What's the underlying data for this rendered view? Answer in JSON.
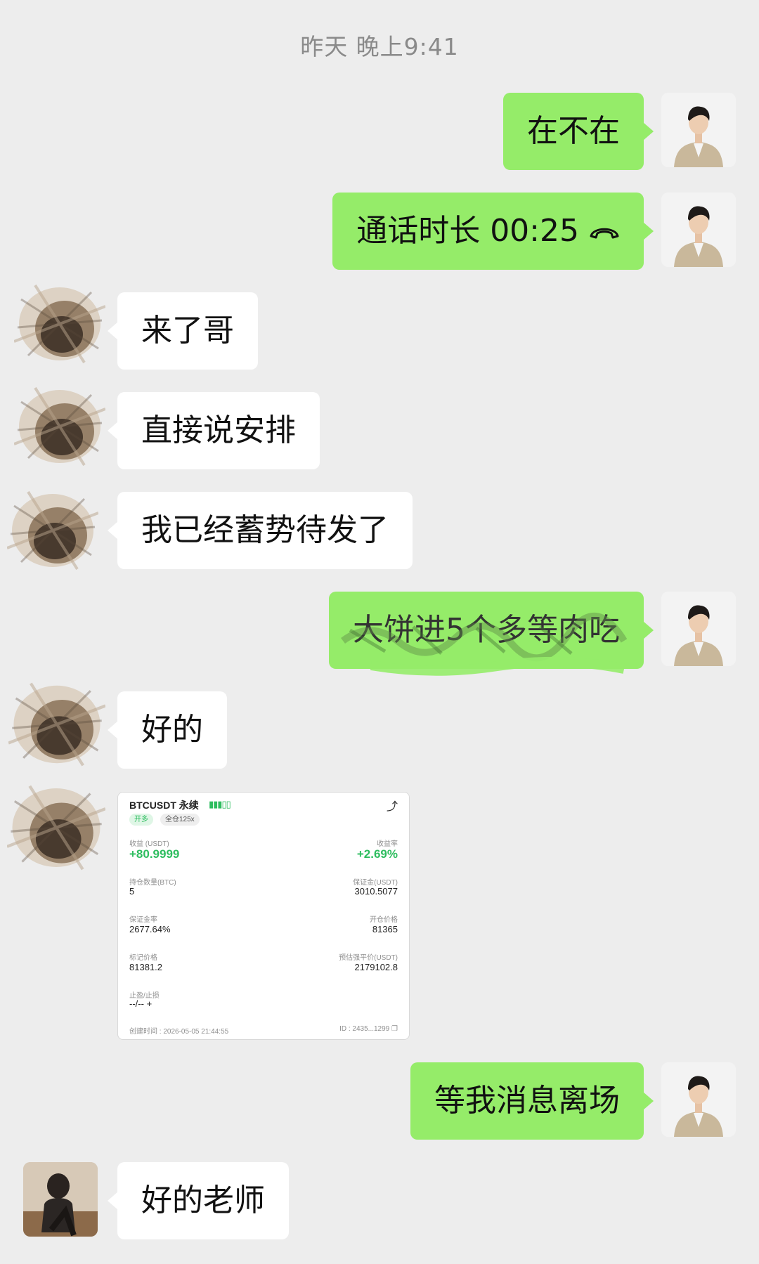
{
  "chat": {
    "timestamp": "昨天 晚上9:41",
    "messages": {
      "m1": "在不在",
      "m2": "通话时长 00:25",
      "m3": "来了哥",
      "m4": "直接说安排",
      "m5": "我已经蓄势待发了",
      "m6": "大饼进5个多等肉吃",
      "m7": "好的",
      "m9": "等我消息离场",
      "m10": "好的老师"
    }
  },
  "trade_card": {
    "symbol": "BTCUSDT 永续",
    "tag_side": "开多",
    "tag_margin": "全仓125x",
    "pnl_label": "收益 (USDT)",
    "pnl_value": "+80.9999",
    "roi_label": "收益率",
    "roi_value": "+2.69%",
    "size_label": "持仓数量(BTC)",
    "size_value": "5",
    "margin_label": "保证金(USDT)",
    "margin_value": "3010.5077",
    "margin_rate_label": "保证金率",
    "margin_rate_value": "2677.64%",
    "entry_label": "开仓价格",
    "entry_value": "81365",
    "mark_label": "标记价格",
    "mark_value": "81381.2",
    "liq_label": "预估强平价(USDT)",
    "liq_value": "2179102.8",
    "tpsl_label": "止盈/止损",
    "tpsl_value": "--/--",
    "created_time": "创建时间 : 2026-05-05 21:44:55",
    "order_id": "ID : 2435...1299"
  },
  "colors": {
    "background": "#ededed",
    "my_bubble": "#95ec69",
    "other_bubble": "#ffffff",
    "profit_green": "#2ebd5f"
  }
}
